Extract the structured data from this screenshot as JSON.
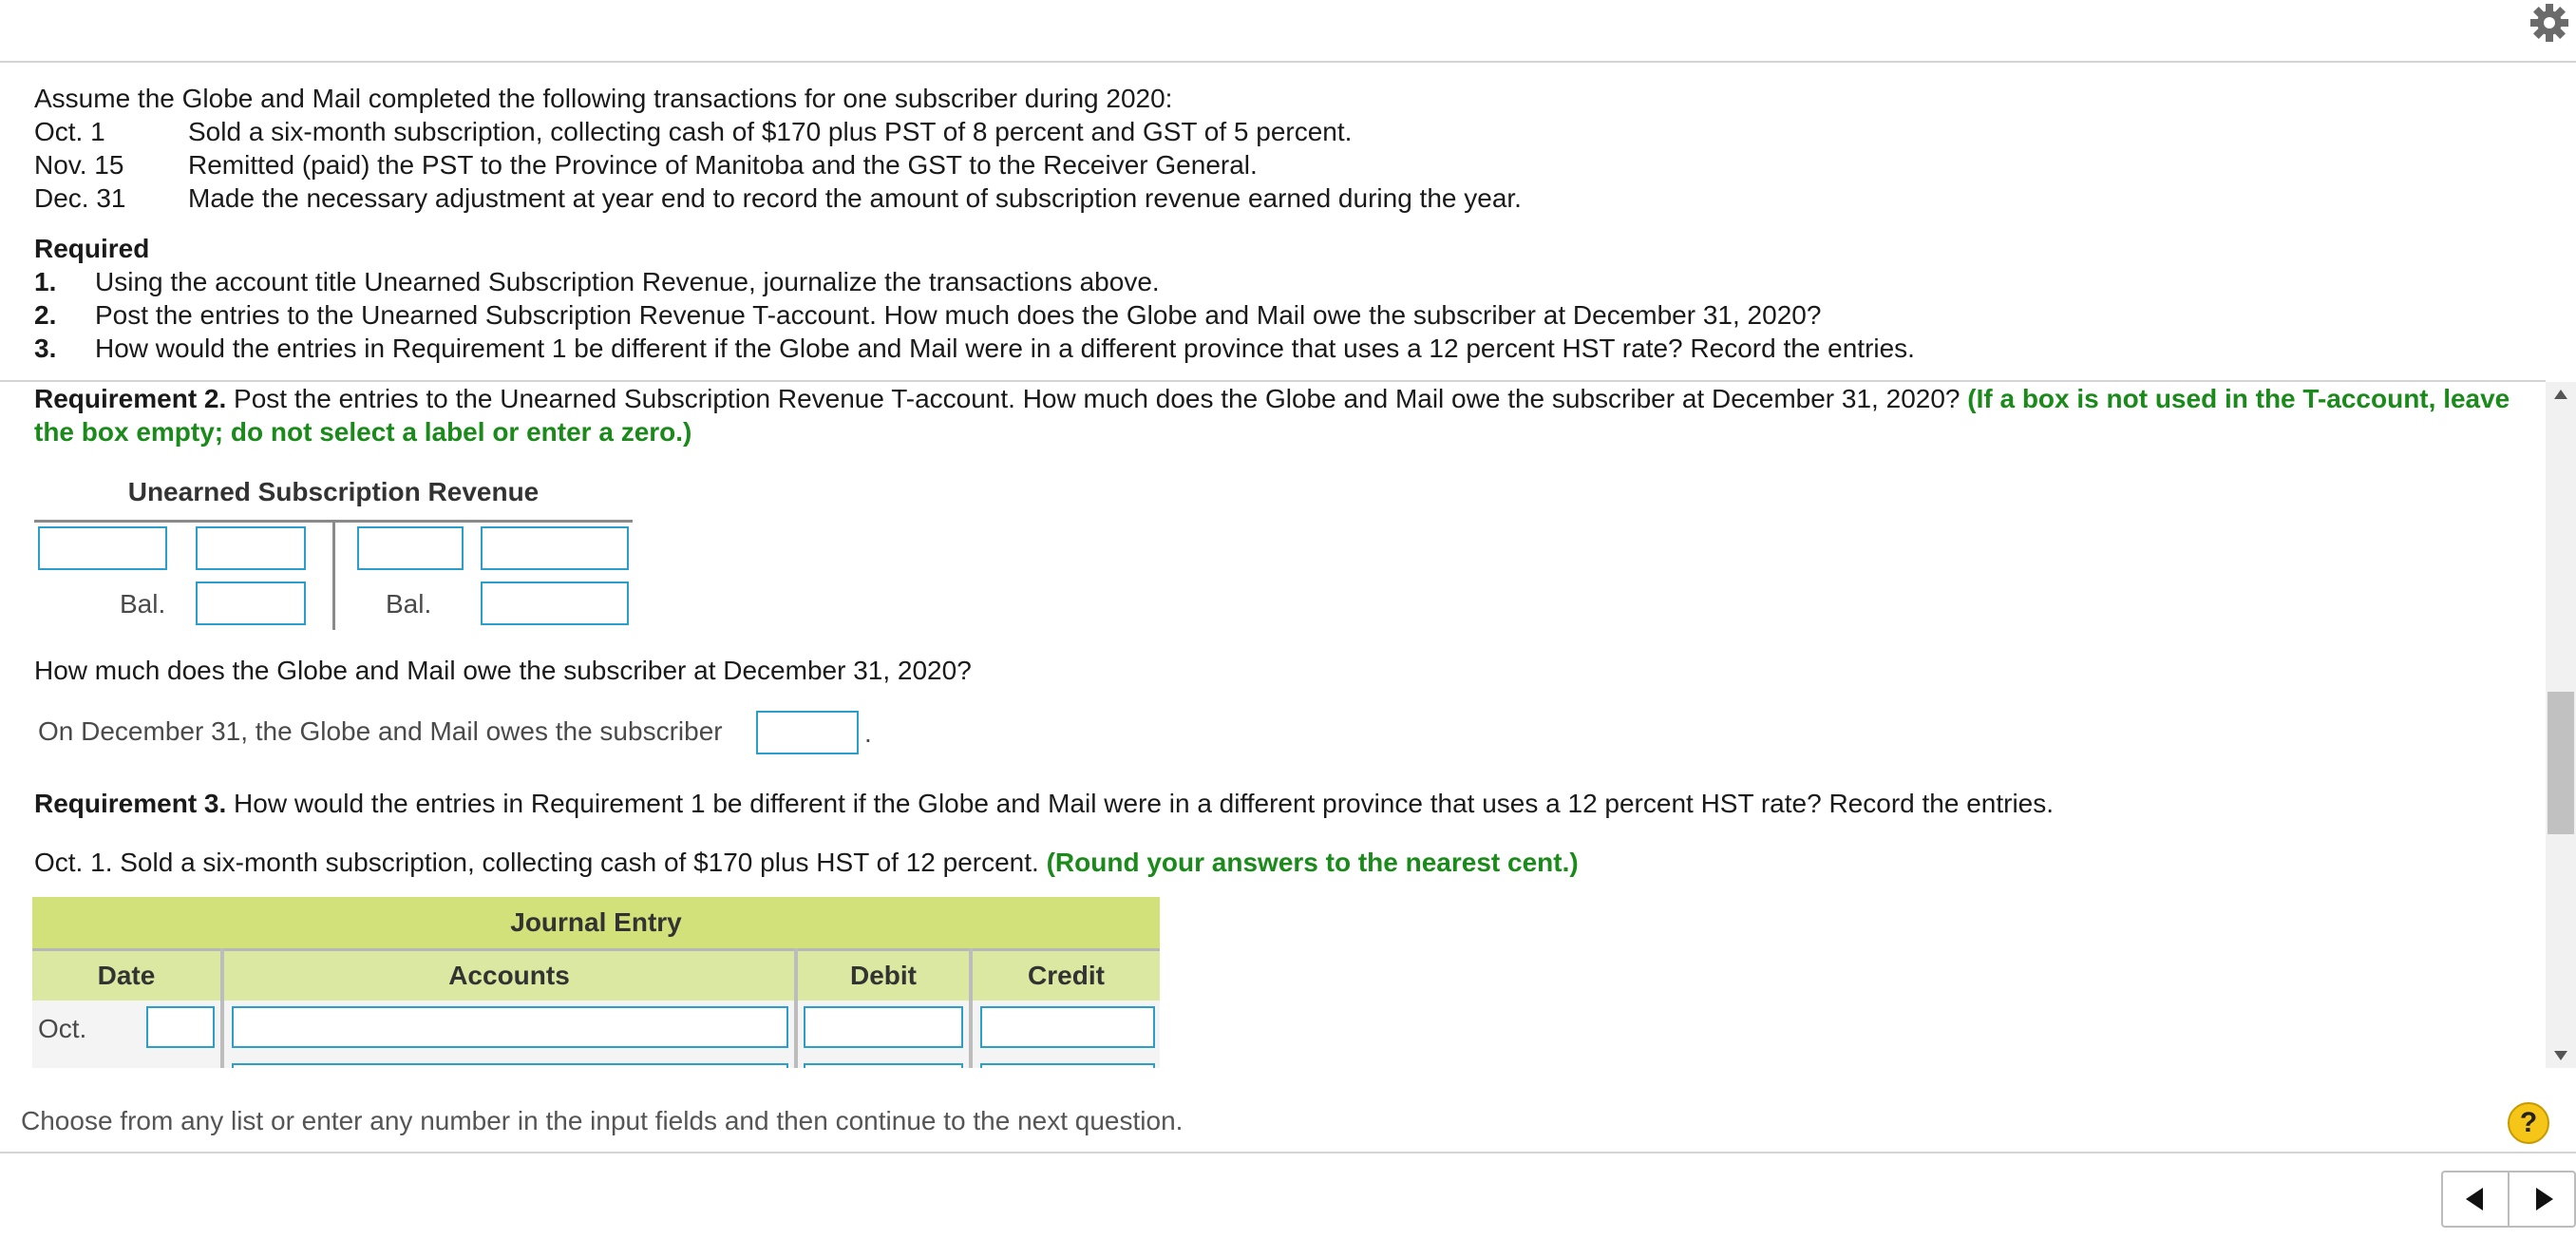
{
  "problem": {
    "intro": "Assume the Globe and Mail completed the following transactions for one subscriber during 2020:",
    "transactions": [
      {
        "date": "Oct. 1",
        "text": "Sold a six-month subscription, collecting cash of $170 plus PST of 8 percent and GST of 5 percent."
      },
      {
        "date": "Nov. 15",
        "text": "Remitted (paid) the PST to the Province of Manitoba and the GST to the Receiver General."
      },
      {
        "date": "Dec. 31",
        "text": "Made the necessary adjustment at year end to record the amount of subscription revenue earned during the year."
      }
    ],
    "required_title": "Required",
    "requirements": [
      {
        "num": "1.",
        "text": "Using the account title Unearned Subscription Revenue, journalize the transactions above."
      },
      {
        "num": "2.",
        "text": "Post the entries to the Unearned Subscription Revenue T-account. How much does the Globe and Mail owe the subscriber at December 31, 2020?"
      },
      {
        "num": "3.",
        "text": "How would the entries in Requirement 1 be different if the Globe and Mail were in a different province that uses a 12 percent HST rate? Record the entries."
      }
    ]
  },
  "req2": {
    "label": "Requirement 2.",
    "text": " Post the entries to the Unearned Subscription Revenue T-account. How much does the Globe and Mail owe the subscriber at December 31, 2020? ",
    "note": "(If a box is not used in the T-account, leave the box empty; do not select a label or enter a zero.)"
  },
  "taccount": {
    "title": "Unearned Subscription Revenue",
    "bal_left": "Bal.",
    "bal_right": "Bal."
  },
  "owe_question": "How much does the Globe and Mail owe the subscriber at December 31, 2020?",
  "owe_answer": {
    "prefix": "On December 31, the Globe and Mail owes the subscriber",
    "suffix": "."
  },
  "req3": {
    "label": "Requirement 3.",
    "text": " How would the entries in Requirement 1 be different if the Globe and Mail were in a different province that uses a 12 percent HST rate? Record the entries."
  },
  "oct1": {
    "text": "Oct. 1. Sold a six-month subscription, collecting cash of $170 plus HST of 12 percent. ",
    "note": "(Round your answers to the nearest cent.)"
  },
  "journal": {
    "title": "Journal Entry",
    "columns": [
      "Date",
      "Accounts",
      "Debit",
      "Credit"
    ],
    "row1_month": "Oct."
  },
  "footer": {
    "instruction": "Choose from any list or enter any number in the input fields and then continue to the next question.",
    "help": "?"
  }
}
